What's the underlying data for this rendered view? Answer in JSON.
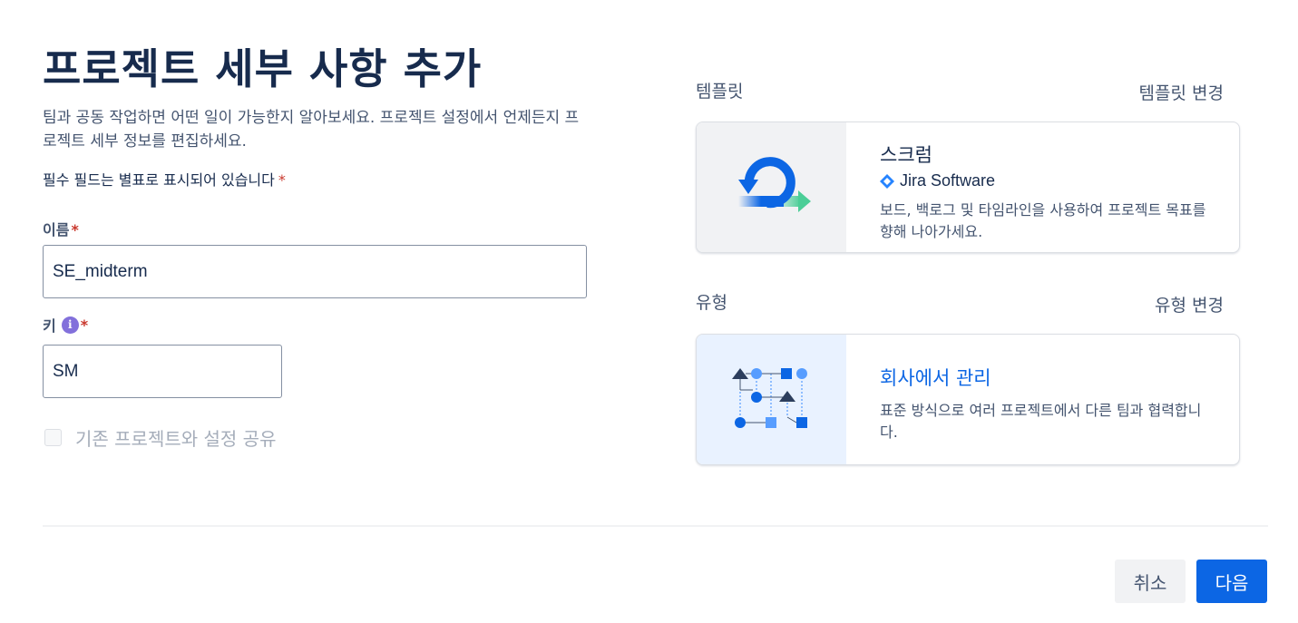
{
  "page": {
    "title": "프로젝트 세부 사항 추가",
    "description": "팀과 공동 작업하면 어떤 일이 가능한지 알아보세요. 프로젝트 설정에서 언제든지 프로젝트 세부 정보를 편집하세요.",
    "required_note": "필수 필드는 별표로 표시되어 있습니다",
    "asterisk": "*"
  },
  "form": {
    "name_label": "이름",
    "name_value": "SE_midterm",
    "key_label": "키",
    "key_value": "SM",
    "info_glyph": "i",
    "share_label": "기존 프로젝트와 설정 공유",
    "share_checked": false
  },
  "template": {
    "section_title": "템플릿",
    "change_link": "템플릿 변경",
    "card_title": "스크럼",
    "brand": "Jira Software",
    "card_desc": "보드, 백로그 및 타임라인을 사용하여 프로젝트 목표를 향해 나아가세요.",
    "icon": "scrum-cycle-icon"
  },
  "type": {
    "section_title": "유형",
    "change_link": "유형 변경",
    "card_title": "회사에서 관리",
    "card_desc": "표준 방식으로 여러 프로젝트에서 다른 팀과 협력합니다.",
    "icon": "company-managed-icon"
  },
  "footer": {
    "cancel_label": "취소",
    "next_label": "다음"
  },
  "colors": {
    "primary": "#0C66E4",
    "text": "#172B4D",
    "required": "#C9372C",
    "info": "#8270DB"
  }
}
